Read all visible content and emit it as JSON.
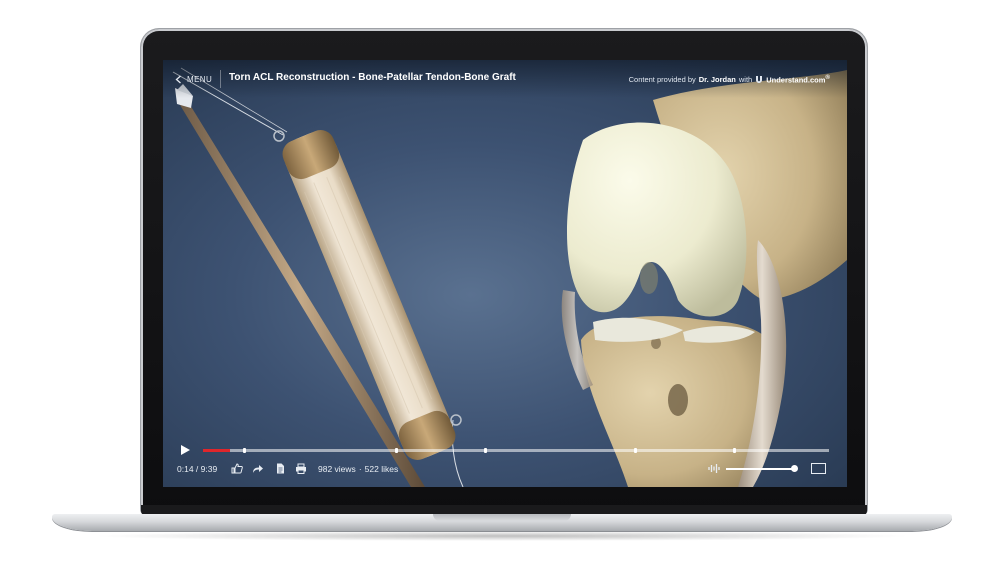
{
  "menu": {
    "label": "MENU"
  },
  "video": {
    "title": "Torn ACL Reconstruction - Bone-Patellar Tendon-Bone Graft"
  },
  "credit": {
    "prefix": "Content provided by",
    "author": "Dr. Jordan",
    "with": "with",
    "brand": "Understand.com",
    "brand_mark": "®"
  },
  "player": {
    "current_time": "0:14",
    "separator": " / ",
    "duration": "9:39",
    "progress_fraction": 0.043,
    "chapter_markers_fraction": [
      0.066,
      0.308,
      0.451,
      0.69,
      0.848
    ],
    "views": "982 views",
    "dot": "·",
    "likes": "522 likes",
    "volume_fraction": 1.0
  },
  "icons": {
    "back": "chevron-left-icon",
    "play": "play-icon",
    "like": "thumbs-up-icon",
    "share": "share-icon",
    "transcript": "document-icon",
    "print": "print-icon",
    "audio": "audio-waveform-icon",
    "fullscreen": "fullscreen-icon",
    "logo": "understand-logo-icon"
  },
  "colors": {
    "progress": "#e0262b",
    "background": "#3d5272",
    "text": "#ffffff"
  }
}
